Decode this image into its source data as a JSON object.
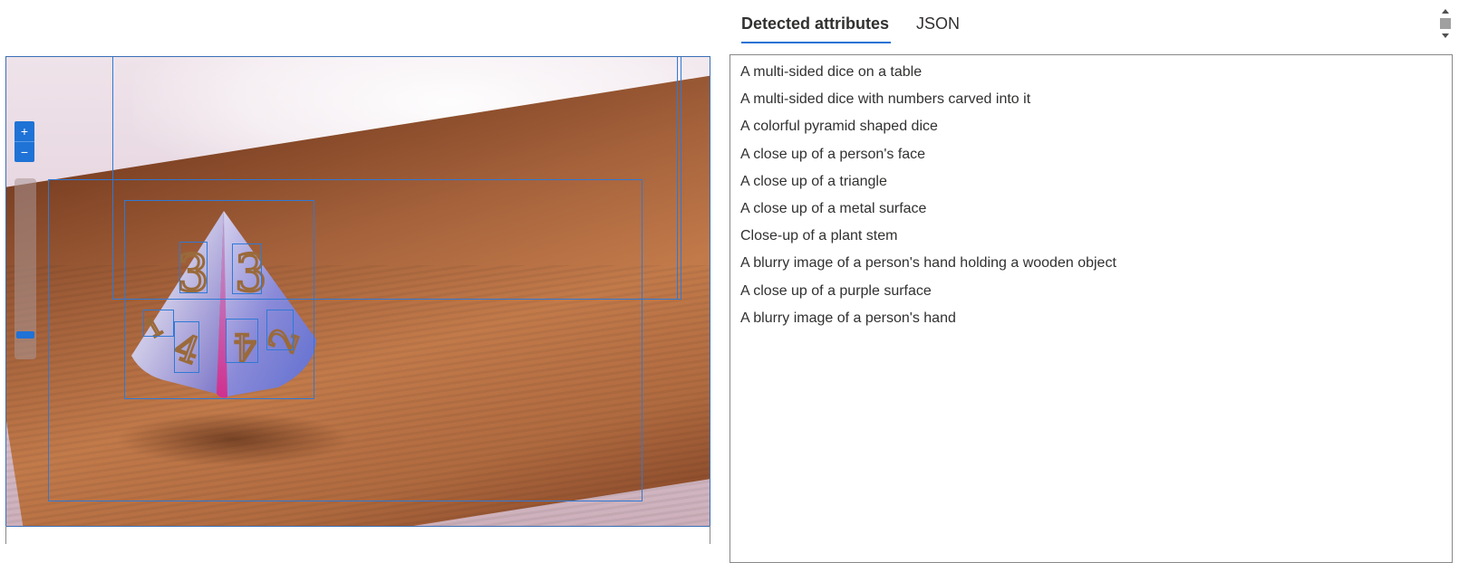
{
  "tabs": [
    {
      "label": "Detected attributes",
      "active": true
    },
    {
      "label": "JSON",
      "active": false
    }
  ],
  "attributes": [
    "A multi-sided dice on a table",
    "A multi-sided dice with numbers carved into it",
    "A colorful pyramid shaped dice",
    "A close up of a person's face",
    "A close up of a triangle",
    "A close up of a metal surface",
    "Close-up of a plant stem",
    "A blurry image of a person's hand holding a wooden object",
    "A close up of a purple surface",
    "A blurry image of a person's hand"
  ],
  "viewer": {
    "zoom_in_label": "+",
    "zoom_out_label": "−",
    "zoom_level": 0.12,
    "image_description_icon": "image-icon"
  },
  "colors": {
    "accent": "#1f72d6",
    "bbox": "#2f79d6",
    "border": "#8a8886"
  }
}
